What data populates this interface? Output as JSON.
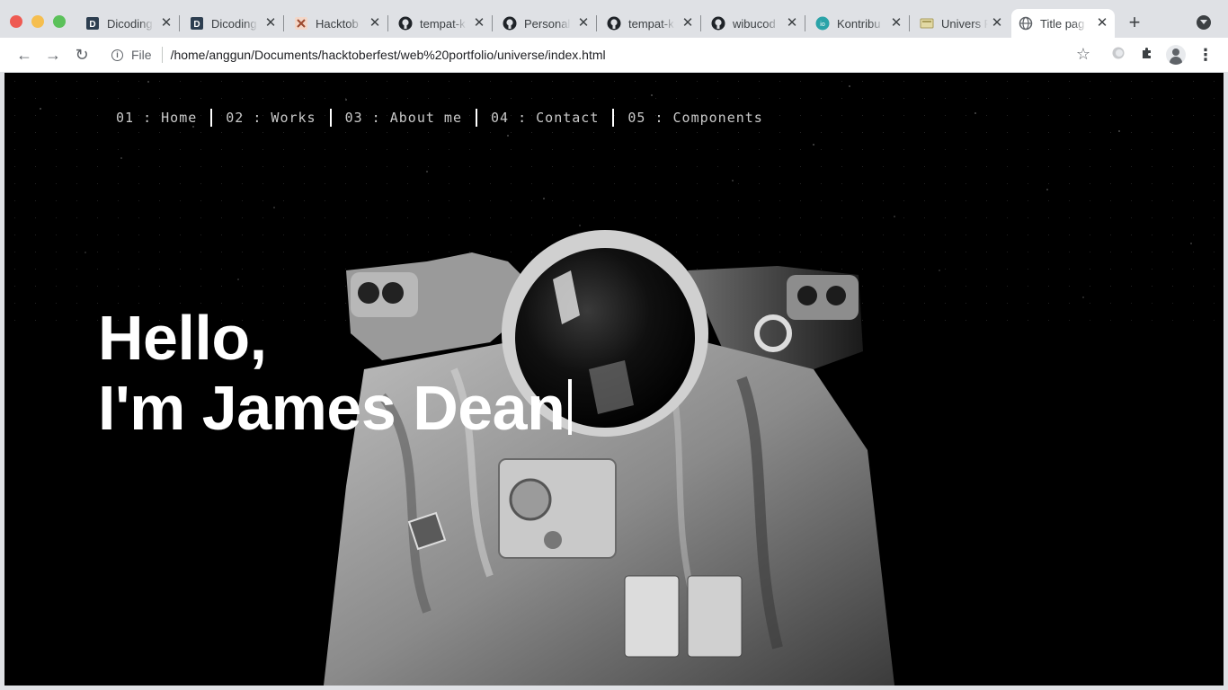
{
  "browser": {
    "tabs": [
      {
        "title": "Dicoding",
        "icon": "dicoding-icon",
        "active": false
      },
      {
        "title": "Dicoding",
        "icon": "dicoding-icon",
        "active": false
      },
      {
        "title": "Hacktob",
        "icon": "hacktoberfest-icon",
        "active": false
      },
      {
        "title": "tempat-k",
        "icon": "github-icon",
        "active": false
      },
      {
        "title": "Personal",
        "icon": "github-icon",
        "active": false
      },
      {
        "title": "tempat-k",
        "icon": "github-icon",
        "active": false
      },
      {
        "title": "wibucod",
        "icon": "github-icon",
        "active": false
      },
      {
        "title": "Kontribu",
        "icon": "kontribu-icon",
        "active": false
      },
      {
        "title": "Univers F",
        "icon": "universe-icon",
        "active": false
      },
      {
        "title": "Title pag",
        "icon": "globe-icon",
        "active": true
      }
    ],
    "new_tab_label": "+",
    "scheme_label": "File",
    "url": "/home/anggun/Documents/hacktoberfest/web%20portfolio/universe/index.html"
  },
  "page": {
    "nav": [
      {
        "label": "01 : Home"
      },
      {
        "label": "02 : Works"
      },
      {
        "label": "03 : About me"
      },
      {
        "label": "04 : Contact"
      },
      {
        "label": "05 : Components"
      }
    ],
    "hero": {
      "line1": "Hello,",
      "line2": "I'm James Dean"
    }
  },
  "colors": {
    "background": "#000000",
    "hero_text": "#ffffff",
    "nav_text": "#c9c9c9",
    "chrome_bg": "#dfe1e5"
  }
}
